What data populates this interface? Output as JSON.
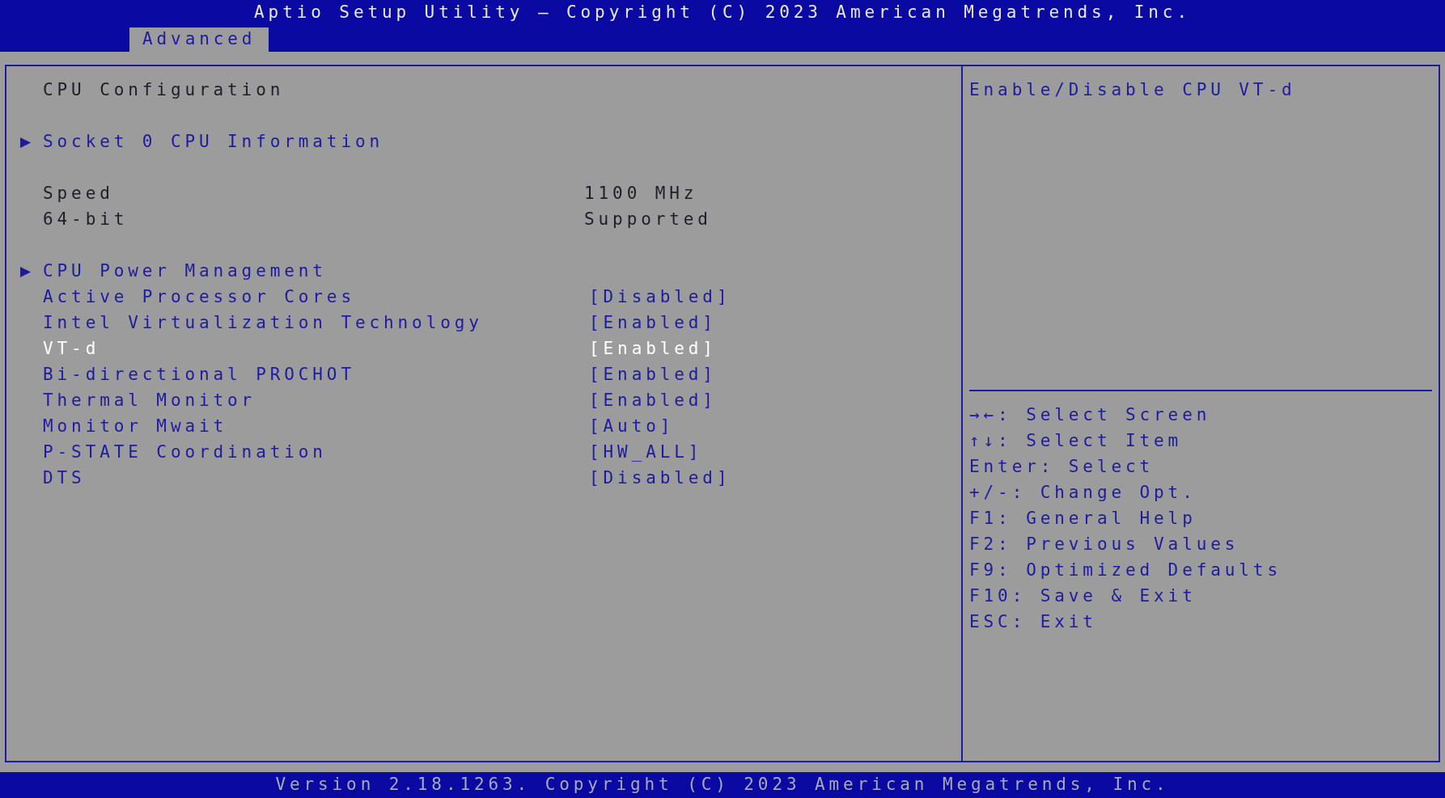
{
  "header": {
    "title": "Aptio Setup Utility – Copyright (C) 2023 American Megatrends, Inc."
  },
  "tabs": [
    {
      "label": "Advanced",
      "selected": true
    }
  ],
  "sections": [
    {
      "items": [
        {
          "kind": "heading",
          "label": "CPU Configuration"
        }
      ]
    },
    {
      "items": [
        {
          "kind": "submenu",
          "label": "Socket 0 CPU Information",
          "selected": false
        }
      ]
    },
    {
      "items": [
        {
          "kind": "info",
          "label": "Speed",
          "value": "1100 MHz"
        },
        {
          "kind": "info",
          "label": "64-bit",
          "value": "Supported"
        }
      ]
    },
    {
      "items": [
        {
          "kind": "submenu",
          "label": "CPU Power Management",
          "selected": false
        },
        {
          "kind": "setting",
          "label": "Active Processor Cores",
          "value": "[Disabled]",
          "selected": false
        },
        {
          "kind": "setting",
          "label": "Intel Virtualization Technology",
          "value": "[Enabled]",
          "selected": false
        },
        {
          "kind": "setting",
          "label": "VT-d",
          "value": "[Enabled]",
          "selected": true
        },
        {
          "kind": "setting",
          "label": "Bi-directional PROCHOT",
          "value": "[Enabled]",
          "selected": false
        },
        {
          "kind": "setting",
          "label": "Thermal Monitor",
          "value": "[Enabled]",
          "selected": false
        },
        {
          "kind": "setting",
          "label": "Monitor Mwait",
          "value": "[Auto]",
          "selected": false
        },
        {
          "kind": "setting",
          "label": "P-STATE Coordination",
          "value": "[HW_ALL]",
          "selected": false
        },
        {
          "kind": "setting",
          "label": "DTS",
          "value": "[Disabled]",
          "selected": false
        }
      ]
    }
  ],
  "help_text": "Enable/Disable CPU VT-d",
  "key_help": [
    "→←: Select Screen",
    "↑↓: Select Item",
    "Enter: Select",
    "+/-: Change Opt.",
    "F1: General Help",
    "F2: Previous Values",
    "F9: Optimized Defaults",
    "F10: Save & Exit",
    "ESC: Exit"
  ],
  "footer": "Version 2.18.1263. Copyright (C) 2023 American Megatrends, Inc."
}
